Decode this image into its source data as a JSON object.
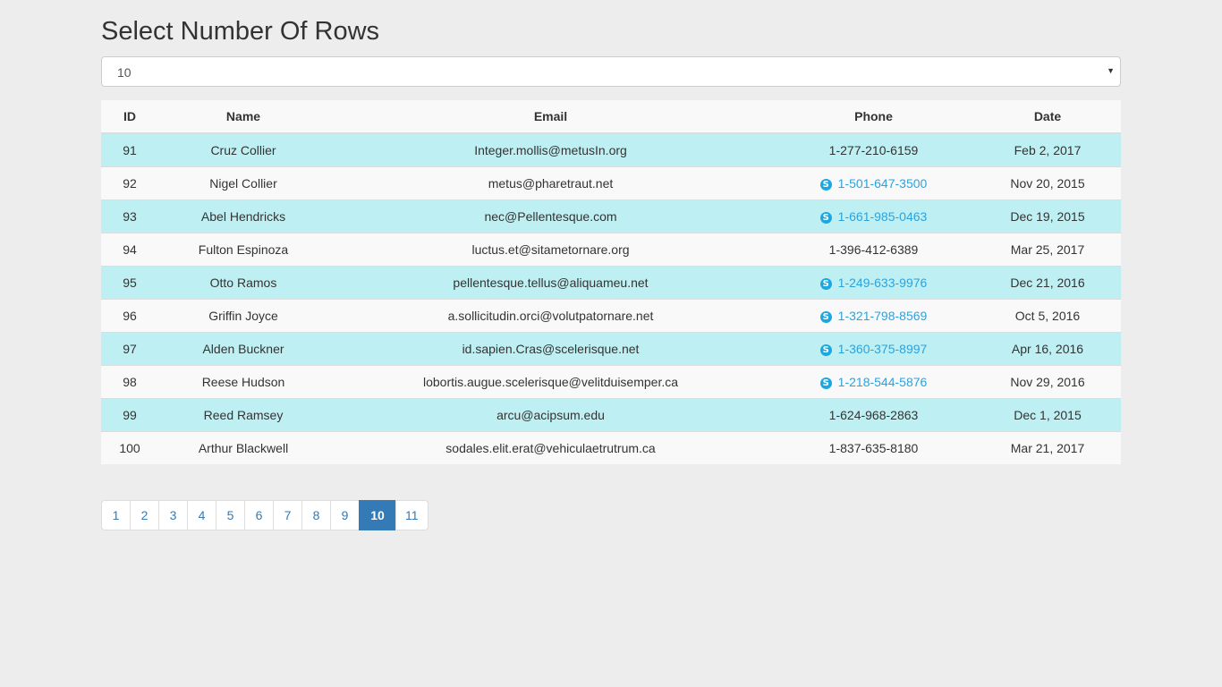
{
  "header": {
    "title": "Select Number Of Rows"
  },
  "rows_select": {
    "value": "10"
  },
  "table": {
    "columns": [
      "ID",
      "Name",
      "Email",
      "Phone",
      "Date"
    ],
    "rows": [
      {
        "id": "91",
        "name": "Cruz Collier",
        "email": "Integer.mollis@metusIn.org",
        "phone": "1-277-210-6159",
        "phone_link": false,
        "date": "Feb 2, 2017",
        "style": "info"
      },
      {
        "id": "92",
        "name": "Nigel Collier",
        "email": "metus@pharetraut.net",
        "phone": "1-501-647-3500",
        "phone_link": true,
        "date": "Nov 20, 2015",
        "style": "plain"
      },
      {
        "id": "93",
        "name": "Abel Hendricks",
        "email": "nec@Pellentesque.com",
        "phone": "1-661-985-0463",
        "phone_link": true,
        "date": "Dec 19, 2015",
        "style": "info"
      },
      {
        "id": "94",
        "name": "Fulton Espinoza",
        "email": "luctus.et@sitametornare.org",
        "phone": "1-396-412-6389",
        "phone_link": false,
        "date": "Mar 25, 2017",
        "style": "plain"
      },
      {
        "id": "95",
        "name": "Otto Ramos",
        "email": "pellentesque.tellus@aliquameu.net",
        "phone": "1-249-633-9976",
        "phone_link": true,
        "date": "Dec 21, 2016",
        "style": "info"
      },
      {
        "id": "96",
        "name": "Griffin Joyce",
        "email": "a.sollicitudin.orci@volutpatornare.net",
        "phone": "1-321-798-8569",
        "phone_link": true,
        "date": "Oct 5, 2016",
        "style": "plain"
      },
      {
        "id": "97",
        "name": "Alden Buckner",
        "email": "id.sapien.Cras@scelerisque.net",
        "phone": "1-360-375-8997",
        "phone_link": true,
        "date": "Apr 16, 2016",
        "style": "info"
      },
      {
        "id": "98",
        "name": "Reese Hudson",
        "email": "lobortis.augue.scelerisque@velitduisemper.ca",
        "phone": "1-218-544-5876",
        "phone_link": true,
        "date": "Nov 29, 2016",
        "style": "plain"
      },
      {
        "id": "99",
        "name": "Reed Ramsey",
        "email": "arcu@acipsum.edu",
        "phone": "1-624-968-2863",
        "phone_link": false,
        "date": "Dec 1, 2015",
        "style": "info"
      },
      {
        "id": "100",
        "name": "Arthur Blackwell",
        "email": "sodales.elit.erat@vehiculaetrutrum.ca",
        "phone": "1-837-635-8180",
        "phone_link": false,
        "date": "Mar 21, 2017",
        "style": "plain"
      }
    ]
  },
  "pagination": {
    "pages": [
      "1",
      "2",
      "3",
      "4",
      "5",
      "6",
      "7",
      "8",
      "9",
      "10",
      "11"
    ],
    "active": "10"
  },
  "icons": {
    "phone_link_icon": "skype-icon",
    "select_caret_icon": "caret-down-icon"
  },
  "colors": {
    "info_row": "#bef0f3",
    "plain_row": "#f9f9f9",
    "active_page": "#337ab7",
    "link": "#2ca2dd"
  }
}
